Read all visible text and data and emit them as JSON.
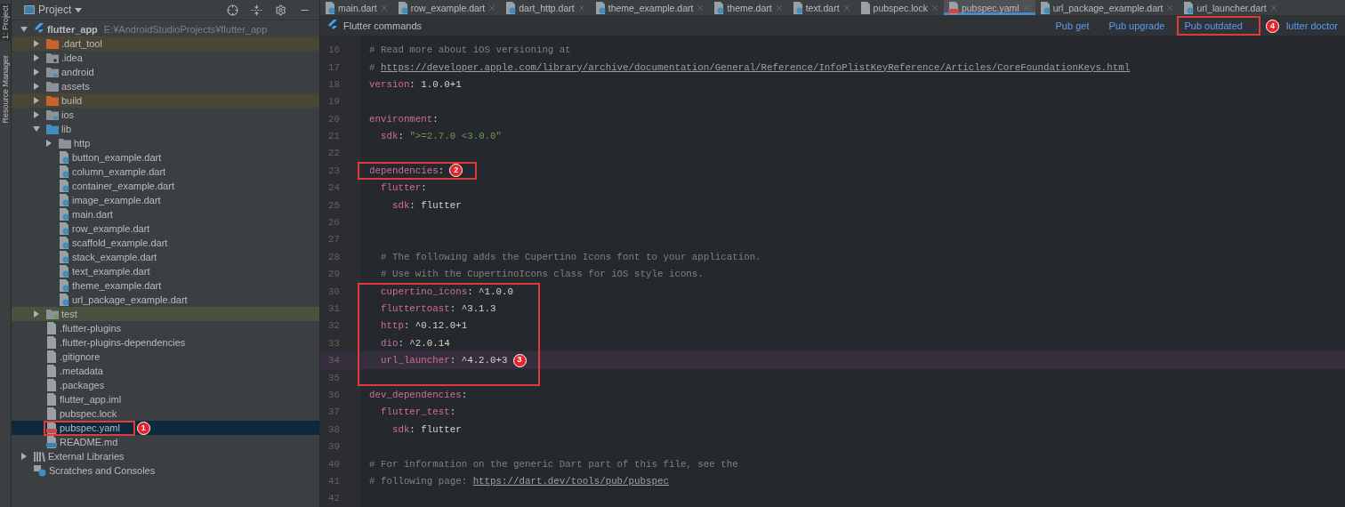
{
  "tool_strip": [
    "1: Project",
    "Resource Manager"
  ],
  "project_panel": {
    "title": "Project",
    "tree": [
      {
        "label": "flutter_app",
        "path": "E:¥AndroidStudioProjects¥flutter_app",
        "kind": "project",
        "expanded": true,
        "selected": false,
        "children": [
          {
            "label": ".dart_tool",
            "kind": "excluded_folder",
            "color": "#4a4636",
            "expanded": false,
            "selected": false
          },
          {
            "label": ".idea",
            "kind": "config_folder",
            "expanded": false,
            "selected": false
          },
          {
            "label": "android",
            "kind": "module_folder",
            "expanded": false,
            "selected": false
          },
          {
            "label": "assets",
            "kind": "folder",
            "expanded": false,
            "selected": false
          },
          {
            "label": "build",
            "kind": "excluded_folder",
            "color": "#4a4636",
            "expanded": false,
            "selected": false
          },
          {
            "label": "ios",
            "kind": "module_folder",
            "expanded": false,
            "selected": false
          },
          {
            "label": "lib",
            "kind": "source_folder",
            "expanded": true,
            "selected": false,
            "children": [
              {
                "label": "http",
                "kind": "folder",
                "expanded": false,
                "selected": false
              },
              {
                "label": "button_example.dart",
                "kind": "dart",
                "selected": false
              },
              {
                "label": "column_example.dart",
                "kind": "dart",
                "selected": false
              },
              {
                "label": "container_example.dart",
                "kind": "dart",
                "selected": false
              },
              {
                "label": "image_example.dart",
                "kind": "dart",
                "selected": false
              },
              {
                "label": "main.dart",
                "kind": "dart",
                "selected": false
              },
              {
                "label": "row_example.dart",
                "kind": "dart",
                "selected": false
              },
              {
                "label": "scaffold_example.dart",
                "kind": "dart",
                "selected": false
              },
              {
                "label": "stack_example.dart",
                "kind": "dart",
                "selected": false
              },
              {
                "label": "text_example.dart",
                "kind": "dart",
                "selected": false
              },
              {
                "label": "theme_example.dart",
                "kind": "dart",
                "selected": false
              },
              {
                "label": "url_package_example.dart",
                "kind": "dart",
                "selected": false
              }
            ]
          },
          {
            "label": "test",
            "kind": "test_folder",
            "color": "#49513f",
            "expanded": false,
            "selected": false
          },
          {
            "label": ".flutter-plugins",
            "kind": "file",
            "selected": false
          },
          {
            "label": ".flutter-plugins-dependencies",
            "kind": "file",
            "selected": false
          },
          {
            "label": ".gitignore",
            "kind": "file",
            "selected": false
          },
          {
            "label": ".metadata",
            "kind": "file",
            "selected": false
          },
          {
            "label": ".packages",
            "kind": "file",
            "selected": false
          },
          {
            "label": "flutter_app.iml",
            "kind": "file",
            "selected": false
          },
          {
            "label": "pubspec.lock",
            "kind": "file",
            "selected": false
          },
          {
            "label": "pubspec.yaml",
            "kind": "yaml",
            "selected": true,
            "callout": "1"
          },
          {
            "label": "README.md",
            "kind": "markdown",
            "selected": false
          }
        ]
      },
      {
        "label": "External Libraries",
        "kind": "libraries",
        "expanded": false,
        "selected": false
      },
      {
        "label": "Scratches and Consoles",
        "kind": "scratches",
        "selected": false
      }
    ]
  },
  "tabs": [
    {
      "label": "main.dart",
      "kind": "dart",
      "selected": false
    },
    {
      "label": "row_example.dart",
      "kind": "dart",
      "selected": false
    },
    {
      "label": "dart_http.dart",
      "kind": "dart",
      "selected": false
    },
    {
      "label": "theme_example.dart",
      "kind": "dart",
      "selected": false
    },
    {
      "label": "theme.dart",
      "kind": "dart",
      "selected": false
    },
    {
      "label": "text.dart",
      "kind": "dart",
      "selected": false
    },
    {
      "label": "pubspec.lock",
      "kind": "file",
      "selected": false
    },
    {
      "label": "pubspec.yaml",
      "kind": "yaml",
      "selected": true
    },
    {
      "label": "url_package_example.dart",
      "kind": "dart",
      "selected": false
    },
    {
      "label": "url_launcher.dart",
      "kind": "dart",
      "selected": false
    }
  ],
  "flutter_commands": {
    "title": "Flutter commands",
    "actions": [
      {
        "label": "Pub get"
      },
      {
        "label": "Pub upgrade"
      },
      {
        "label": "Pub outdated",
        "callout": "4"
      },
      {
        "label": "lutter doctor"
      }
    ]
  },
  "code_lines": [
    {
      "number": "16",
      "parts": [
        {
          "kind": "comment",
          "text": "# Read more about iOS versioning at"
        }
      ]
    },
    {
      "number": "17",
      "parts": [
        {
          "kind": "comment",
          "text": "# "
        },
        {
          "kind": "link",
          "text": "https://developer.apple.com/library/archive/documentation/General/Reference/InfoPlistKeyReference/Articles/CoreFoundationKeys.html"
        }
      ]
    },
    {
      "number": "18",
      "parts": [
        {
          "kind": "key",
          "text": "version"
        },
        {
          "kind": "value",
          "text": ": 1.0.0+1"
        }
      ]
    },
    {
      "number": "19"
    },
    {
      "number": "20",
      "parts": [
        {
          "kind": "key",
          "text": "environment"
        },
        {
          "kind": "value",
          "text": ":"
        }
      ]
    },
    {
      "number": "21",
      "parts": [
        {
          "kind": "key",
          "text": "  sdk"
        },
        {
          "kind": "value",
          "text": ": "
        },
        {
          "kind": "string",
          "text": "\">=2.7.0 <3.0.0\""
        }
      ]
    },
    {
      "number": "22"
    },
    {
      "number": "23",
      "boxed": true,
      "callout": "2",
      "parts": [
        {
          "kind": "key",
          "text": "dependencies"
        },
        {
          "kind": "value",
          "text": ":"
        }
      ]
    },
    {
      "number": "24",
      "parts": [
        {
          "kind": "key",
          "text": "  flutter"
        },
        {
          "kind": "value",
          "text": ":"
        }
      ]
    },
    {
      "number": "25",
      "parts": [
        {
          "kind": "key",
          "text": "    sdk"
        },
        {
          "kind": "value",
          "text": ": flutter"
        }
      ]
    },
    {
      "number": "26"
    },
    {
      "number": "27"
    },
    {
      "number": "28",
      "parts": [
        {
          "kind": "comment",
          "text": "  # The following adds the Cupertino Icons font to your application."
        }
      ]
    },
    {
      "number": "29",
      "parts": [
        {
          "kind": "comment",
          "text": "  # Use with the CupertinoIcons class for iOS style icons."
        }
      ]
    },
    {
      "number": "30",
      "boxed": true,
      "parts": [
        {
          "kind": "key",
          "text": "  cupertino_icons"
        },
        {
          "kind": "value",
          "text": ": ^1.0.0"
        }
      ]
    },
    {
      "number": "31",
      "boxed": true,
      "parts": [
        {
          "kind": "key",
          "text": "  fluttertoast"
        },
        {
          "kind": "value",
          "text": ": ^3.1.3"
        }
      ]
    },
    {
      "number": "32",
      "boxed": true,
      "parts": [
        {
          "kind": "key",
          "text": "  http"
        },
        {
          "kind": "value",
          "text": ": ^0.12.0+1"
        }
      ]
    },
    {
      "number": "33",
      "boxed": true,
      "parts": [
        {
          "kind": "key",
          "text": "  dio"
        },
        {
          "kind": "value",
          "text": ": ^2.0.14"
        }
      ]
    },
    {
      "number": "34",
      "current": true,
      "boxed": true,
      "callout": "3",
      "parts": [
        {
          "kind": "key",
          "text": "  url_launcher"
        },
        {
          "kind": "value",
          "text": ": ^4.2.0+3"
        }
      ]
    },
    {
      "number": "35",
      "boxed": true
    },
    {
      "number": "36",
      "parts": [
        {
          "kind": "key",
          "text": "dev_dependencies"
        },
        {
          "kind": "value",
          "text": ":"
        }
      ]
    },
    {
      "number": "37",
      "parts": [
        {
          "kind": "key",
          "text": "  flutter_test"
        },
        {
          "kind": "value",
          "text": ":"
        }
      ]
    },
    {
      "number": "38",
      "parts": [
        {
          "kind": "key",
          "text": "    sdk"
        },
        {
          "kind": "value",
          "text": ": flutter"
        }
      ]
    },
    {
      "number": "39"
    },
    {
      "number": "40",
      "parts": [
        {
          "kind": "comment",
          "text": "# For information on the generic Dart part of this file, see the"
        }
      ]
    },
    {
      "number": "41",
      "parts": [
        {
          "kind": "comment",
          "text": "# following page: "
        },
        {
          "kind": "link",
          "text": "https://dart.dev/tools/pub/pubspec"
        }
      ]
    },
    {
      "number": "42"
    }
  ]
}
